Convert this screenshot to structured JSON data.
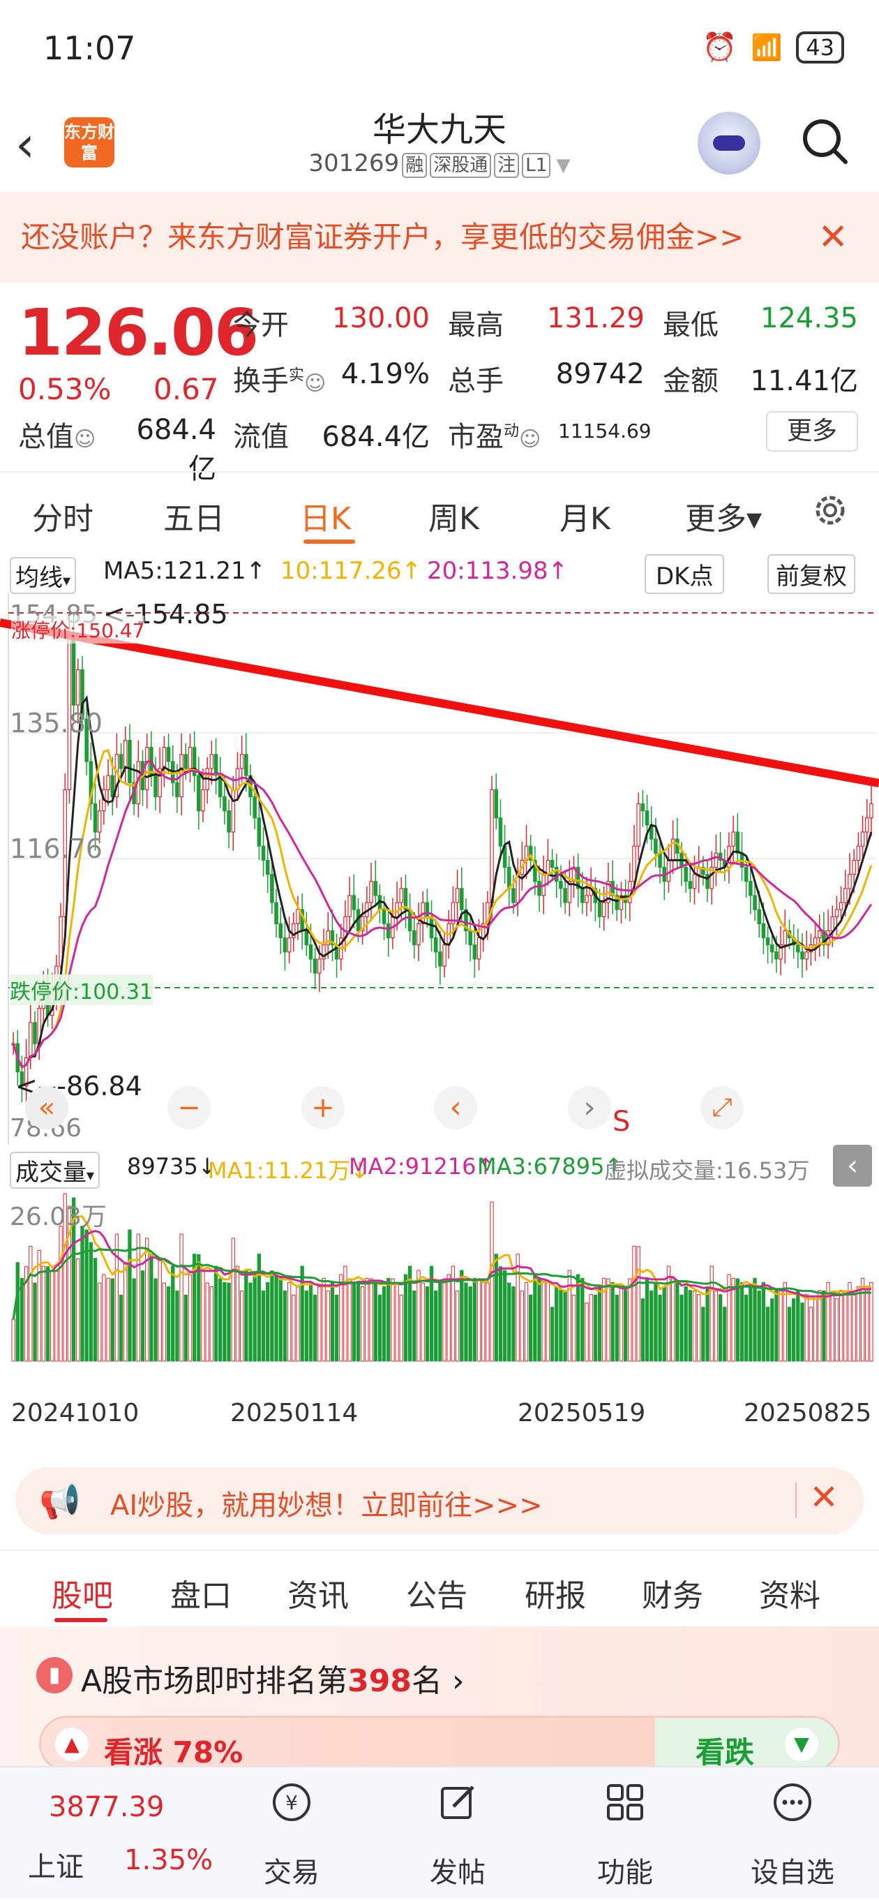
{
  "status_bar": {
    "time": "11:07",
    "battery": "43"
  },
  "header": {
    "back_icon": "chevron-left-icon",
    "logo_text": "东方财富",
    "stock_name": "华大九天",
    "stock_code": "301269",
    "tags": [
      "融",
      "深股通",
      "注",
      "L1"
    ]
  },
  "promo": {
    "text": "还没账户？来东方财富证券开户，享更低的交易佣金>>",
    "close": "✕"
  },
  "quote": {
    "price": "126.06",
    "change_pct": "0.53%",
    "change_amt": "0.67",
    "open_label": "今开",
    "open": "130.00",
    "high_label": "最高",
    "high": "131.29",
    "low_label": "最低",
    "low": "124.35",
    "turnover_label": "换手",
    "turnover_sup": "实",
    "turnover": "4.19%",
    "volume_label": "总手",
    "volume": "89742",
    "amount_label": "金额",
    "amount": "11.41亿",
    "mktcap_label": "总值",
    "mktcap": "684.4亿",
    "float_label": "流值",
    "float": "684.4亿",
    "pe_label": "市盈",
    "pe_sup": "动",
    "pe": "11154.69",
    "more_button": "更多"
  },
  "chart_tabs": [
    {
      "label": "分时"
    },
    {
      "label": "五日"
    },
    {
      "label": "日K",
      "active": true
    },
    {
      "label": "周K"
    },
    {
      "label": "月K"
    },
    {
      "label": "更多▾"
    }
  ],
  "ma_row": {
    "selector": "均线",
    "ma5": "MA5:121.21↑",
    "ma10": "10:117.26↑",
    "ma20": "20:113.98↑",
    "dk_button": "DK点",
    "adjust_button": "前复权"
  },
  "kline": {
    "labels": {
      "top": "154.85",
      "top_marker": "<-154.85",
      "limit_up": "涨停价:150.47",
      "mid1": "135.80",
      "mid2": "116.76",
      "limit_down": "跌停价:100.31",
      "low_marker": "<---86.84",
      "bottom": "78.66",
      "s_marker": "S"
    },
    "controls": [
      "«",
      "−",
      "+",
      "‹",
      "›",
      "⤢"
    ]
  },
  "chart_data": {
    "type": "candlestick",
    "ylim": [
      78.66,
      154.85
    ],
    "closes": [
      92,
      88,
      86,
      90,
      95,
      92,
      97,
      100,
      96,
      99,
      103,
      110,
      128,
      150,
      140,
      145,
      138,
      132,
      126,
      122,
      125,
      128,
      130,
      127,
      133,
      131,
      135,
      129,
      126,
      132,
      128,
      134,
      130,
      127,
      131,
      134,
      132,
      129,
      127,
      133,
      131,
      134,
      130,
      125,
      128,
      131,
      133,
      130,
      127,
      125,
      122,
      128,
      131,
      133,
      130,
      127,
      124,
      120,
      118,
      116,
      112,
      109,
      107,
      105,
      107,
      109,
      111,
      108,
      106,
      104,
      102,
      104,
      106,
      108,
      106,
      104,
      107,
      110,
      113,
      111,
      108,
      110,
      112,
      115,
      113,
      111,
      109,
      107,
      110,
      112,
      114,
      111,
      108,
      106,
      109,
      112,
      110,
      107,
      105,
      103,
      106,
      109,
      112,
      114,
      111,
      108,
      106,
      104,
      107,
      109,
      112,
      128,
      124,
      120,
      117,
      114,
      112,
      116,
      118,
      120,
      118,
      115,
      113,
      116,
      118,
      117,
      115,
      114,
      112,
      115,
      117,
      114,
      112,
      113,
      114,
      112,
      110,
      112,
      115,
      113,
      111,
      113,
      112,
      115,
      120,
      126,
      125,
      123,
      121,
      119,
      117,
      115,
      118,
      121,
      119,
      117,
      115,
      114,
      116,
      117,
      116,
      114,
      117,
      119,
      118,
      117,
      120,
      122,
      119,
      117,
      115,
      113,
      111,
      109,
      107,
      106,
      105,
      104,
      106,
      108,
      107,
      106,
      105,
      104,
      105,
      106,
      107,
      108,
      106,
      108,
      110,
      111,
      112,
      114,
      116,
      118,
      120,
      122,
      124,
      126
    ],
    "ma5": "MA5:121.21",
    "ma10": "10:117.26",
    "ma20": "20:113.98"
  },
  "volume_row": {
    "selector": "成交量",
    "vol": "89735↓",
    "ma1": "MA1:11.21万↓",
    "ma2": "MA2:91216↑",
    "ma3": "MA3:67895↑",
    "virtual": "虚拟成交量:16.53万"
  },
  "volume_axis_label": "26.03万",
  "dates": [
    "20241010",
    "20250114",
    "20250519",
    "20250825"
  ],
  "ai_banner": {
    "text": "AI炒股，就用妙想！立即前往>>>",
    "close": "✕"
  },
  "bottom_tabs": [
    {
      "label": "股吧",
      "active": true
    },
    {
      "label": "盘口"
    },
    {
      "label": "资讯"
    },
    {
      "label": "公告"
    },
    {
      "label": "研报"
    },
    {
      "label": "财务"
    },
    {
      "label": "资料"
    }
  ],
  "rank": {
    "prefix": "A股市场即时排名第",
    "number": "398",
    "suffix": "名 ›"
  },
  "sentiment": {
    "up_label": "看涨 78%",
    "down_label": "看跌"
  },
  "bottom_bar": {
    "index_value": "3877.39",
    "index_name": "上证",
    "index_pct": "1.35%",
    "nav": [
      {
        "label": "交易",
        "icon": "yen-circle-icon"
      },
      {
        "label": "发帖",
        "icon": "edit-icon"
      },
      {
        "label": "功能",
        "icon": "grid-icon"
      },
      {
        "label": "设自选",
        "icon": "more-dots-icon"
      }
    ]
  },
  "colors": {
    "up": "#e0262d",
    "down": "#1a9e35",
    "brand": "#f26a21",
    "ma5": "#222222",
    "ma10": "#f0b400",
    "ma20": "#d0279b"
  }
}
